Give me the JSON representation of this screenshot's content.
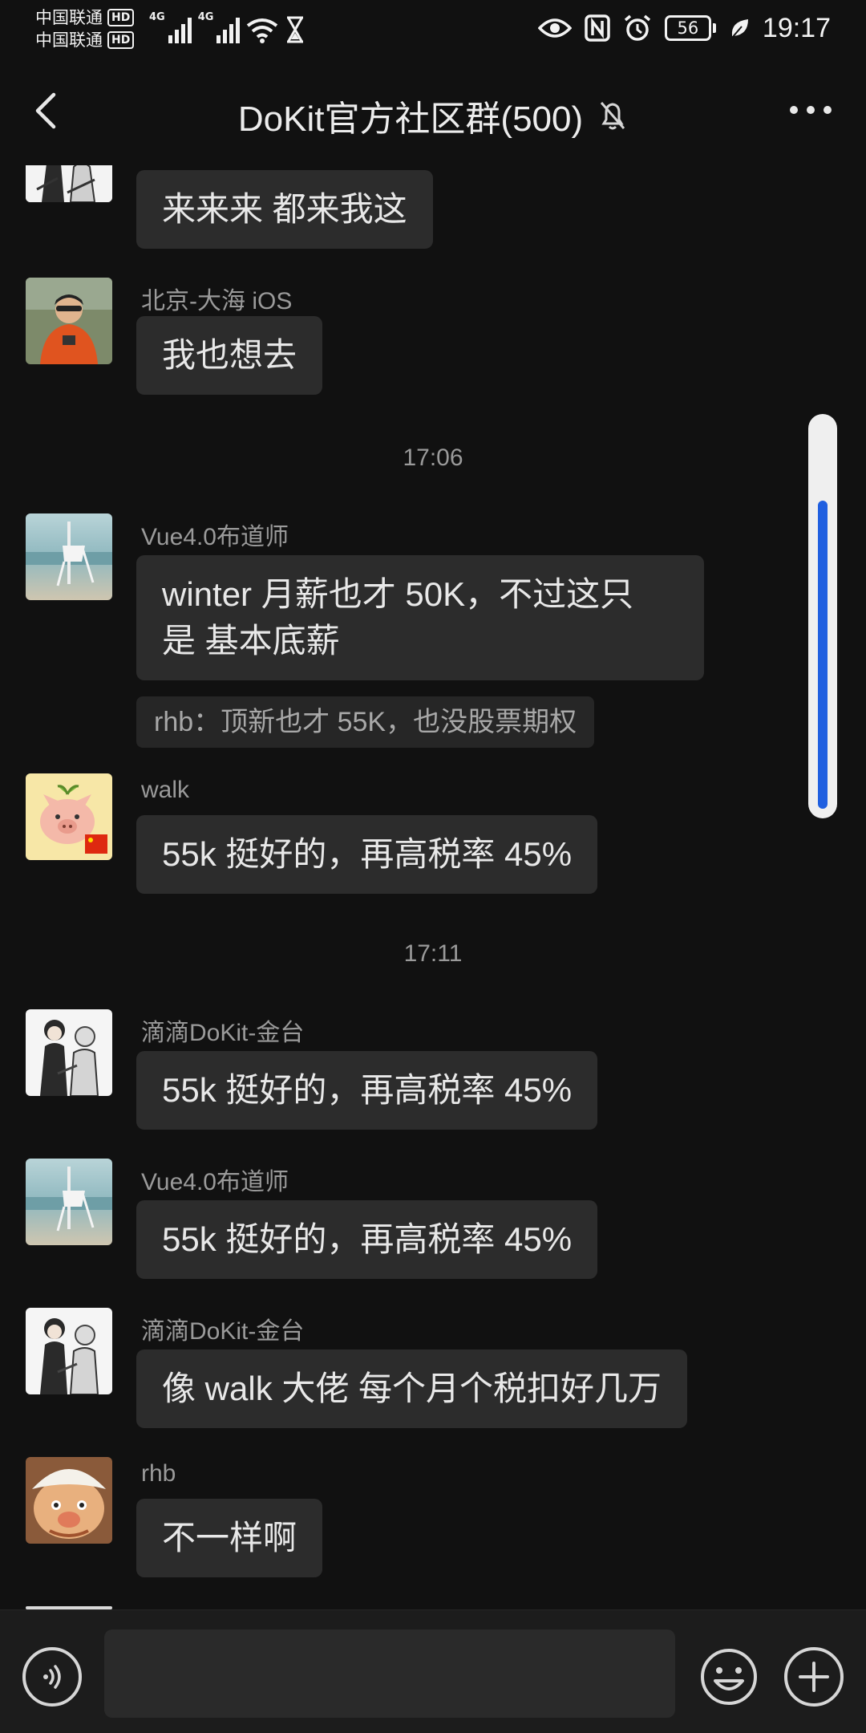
{
  "status_bar": {
    "carrier_1": "中国联通",
    "carrier_2": "中国联通",
    "hd_label": "HD",
    "network_1": "4G",
    "network_2": "4G",
    "battery": "56",
    "time": "19:17",
    "icons": [
      "wifi-icon",
      "hourglass-icon",
      "eye-icon",
      "nfc-icon",
      "alarm-icon",
      "battery-icon",
      "leaf-icon"
    ]
  },
  "header": {
    "title": "DoKit官方社区群(500)",
    "icons": [
      "back-arrow-icon",
      "muted-bell-icon",
      "more-dots-icon"
    ]
  },
  "messages": [
    {
      "text": "来来来 都来我这"
    },
    {
      "sender": "北京-大海 iOS",
      "text": "我也想去"
    },
    {
      "time": "17:06"
    },
    {
      "sender": "Vue4.0布道师",
      "text_line_1": "winter 月薪也才 50K，不过这只",
      "text_line_2": "是 基本底薪",
      "quote": "rhb：顶新也才 55K，也没股票期权"
    },
    {
      "sender": "walk",
      "text": "55k 挺好的，再高税率 45%"
    },
    {
      "time": "17:11"
    },
    {
      "sender": "滴滴DoKit-金台",
      "text": "55k 挺好的，再高税率 45%"
    },
    {
      "sender": "Vue4.0布道师",
      "text": "55k 挺好的，再高税率 45%"
    },
    {
      "sender": "滴滴DoKit-金台",
      "text": "像 walk 大佬 每个月个税扣好几万"
    },
    {
      "sender": "rhb",
      "text": "不一样啊"
    }
  ],
  "scrollbar": {
    "position": 0.2,
    "visible_fraction": 0.8,
    "accent": "#1f5fe0"
  },
  "input_bar": {
    "value": "",
    "icons": [
      "voice-icon",
      "emoji-icon",
      "plus-icon"
    ]
  },
  "colors": {
    "background": "#111111",
    "bubble": "#2c2c2c",
    "accent": "#1f5fe0"
  }
}
